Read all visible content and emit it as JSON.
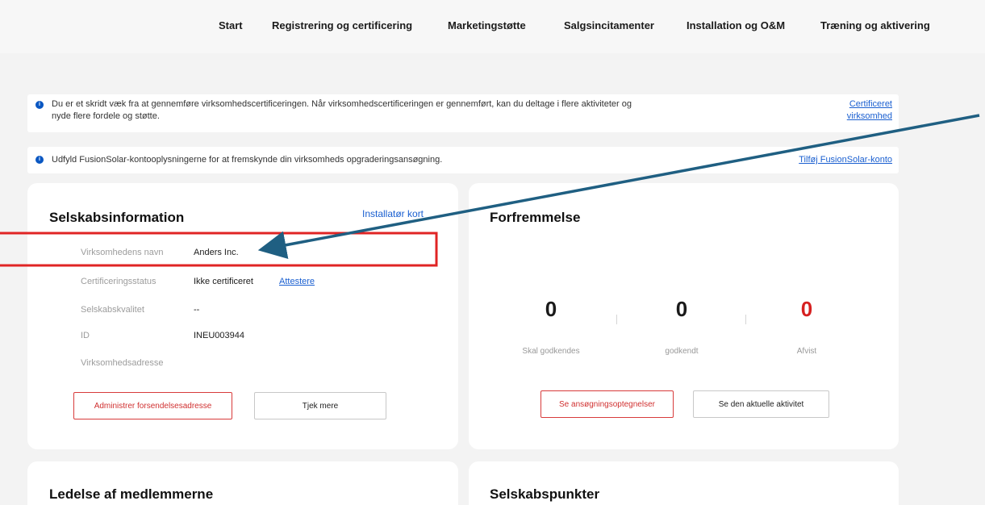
{
  "nav": {
    "items": [
      "Start",
      "Registrering og certificering",
      "Marketingstøtte",
      "Salgsincitamenter",
      "Installation og O&M",
      "Træning og aktivering"
    ]
  },
  "alerts": [
    {
      "message_line1": "Du er et skridt væk fra at gennemføre virksomhedscertificeringen. Når virksomhedscertificeringen er gennemført, kan du deltage i flere aktiviteter og",
      "message_line2": "nyde flere fordele og støtte.",
      "link_line1": "Certificeret",
      "link_line2": "virksomhed"
    },
    {
      "message_line1": "Udfyld FusionSolar-kontooplysningerne for at fremskynde din virksomheds opgraderingsansøgning.",
      "link_line1": "Tilføj FusionSolar-konto"
    }
  ],
  "company_info": {
    "title": "Selskabsinformation",
    "installer_card_link": "Installatør kort",
    "rows": [
      {
        "label": "Virksomhedens navn",
        "value": "Anders Inc."
      },
      {
        "label": "Certificeringsstatus",
        "value": "Ikke certificeret",
        "link": "Attestere"
      },
      {
        "label": "Selskabskvalitet",
        "value": "--"
      },
      {
        "label": "ID",
        "value": "INEU003944"
      },
      {
        "label": "Virksomhedsadresse",
        "value": ""
      }
    ],
    "manage_button": "Administrer forsendelsesadresse",
    "more_button": "Tjek mere"
  },
  "promotion": {
    "title": "Forfremmelse",
    "stats": [
      {
        "value": "0",
        "label": "Skal godkendes"
      },
      {
        "value": "0",
        "label": "godkendt"
      },
      {
        "value": "0",
        "label": "Afvist"
      }
    ],
    "records_button": "Se ansøgningsoptegnelser",
    "activity_button": "Se den aktuelle aktivitet"
  },
  "member_mgmt": {
    "title": "Ledelse af medlemmerne"
  },
  "company_points": {
    "title": "Selskabspunkter"
  },
  "colors": {
    "accent_blue": "#1a5fd0",
    "alert_red": "#d03030",
    "highlight_box": "#e02424",
    "arrow": "#1f5f82"
  }
}
